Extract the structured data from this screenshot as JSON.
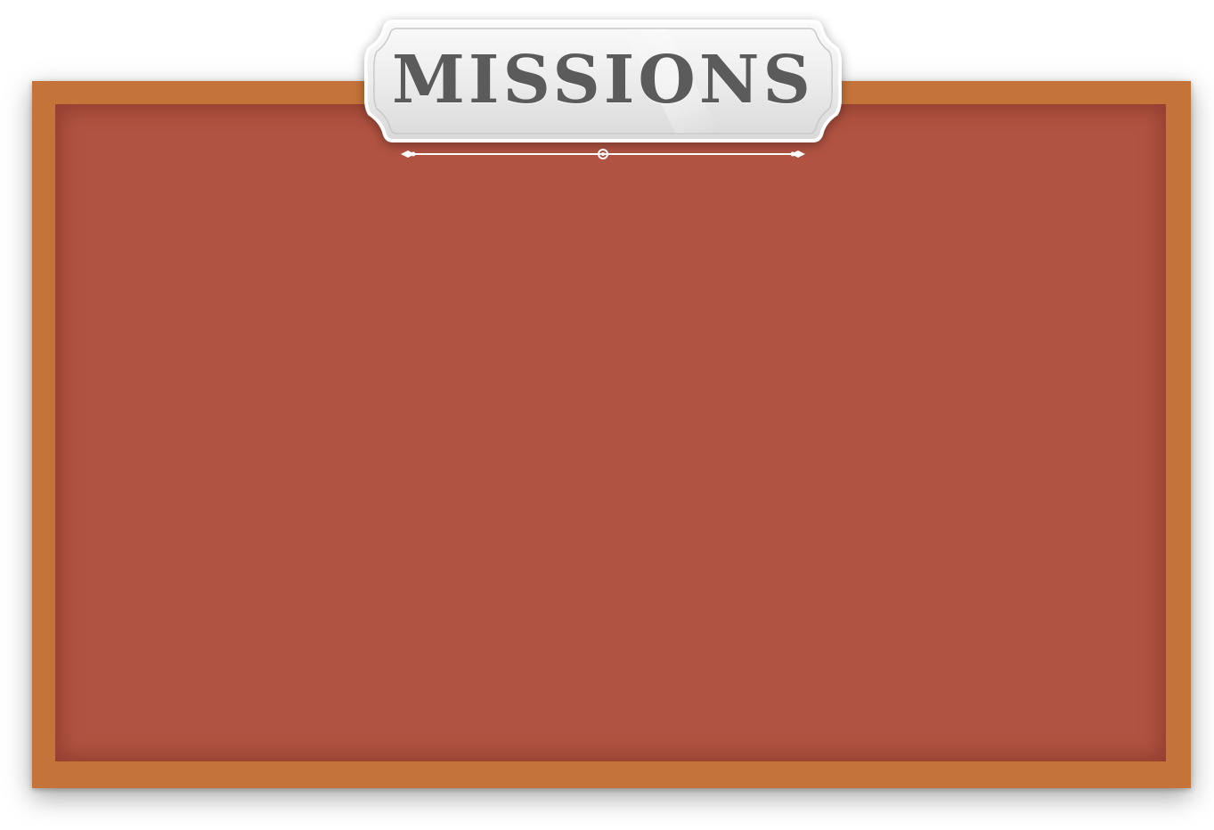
{
  "title": "MISSIONS",
  "colors": {
    "frame": "#c57439",
    "panel": "#b15342",
    "plaque": "#e9e9e9",
    "title_text": "#5b5b5b",
    "divider": "#ffffff"
  },
  "icons": {
    "divider_ornament": "ornamental-divider-icon"
  }
}
